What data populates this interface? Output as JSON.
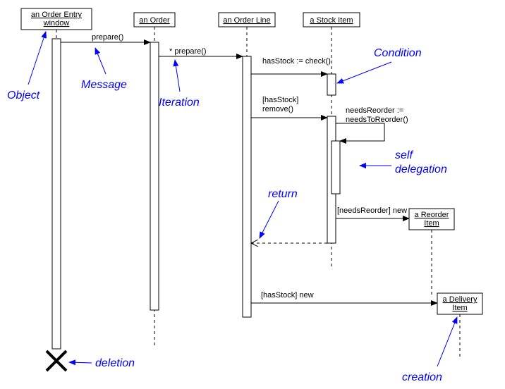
{
  "objects": {
    "orderEntry": "an Order Entry window",
    "order": "an Order",
    "orderLine": "an Order Line",
    "stockItem": "a Stock Item",
    "reorderItem": "a Reorder Item",
    "deliveryItem": "a Delivery Item"
  },
  "messages": {
    "prepare1": "prepare()",
    "prepare2": "* prepare()",
    "check": "hasStock := check()",
    "remove_guard": "[hasStock]",
    "remove": "remove()",
    "needsReorder": "needsReorder := needsToReorder()",
    "newReorder": "[needsReorder] new",
    "newDelivery": "[hasStock] new"
  },
  "annotations": {
    "object": "Object",
    "message": "Message",
    "iteration": "Iteration",
    "condition": "Condition",
    "selfDelegation": "self delegation",
    "return_": "return",
    "deletion": "deletion",
    "creation": "creation"
  }
}
